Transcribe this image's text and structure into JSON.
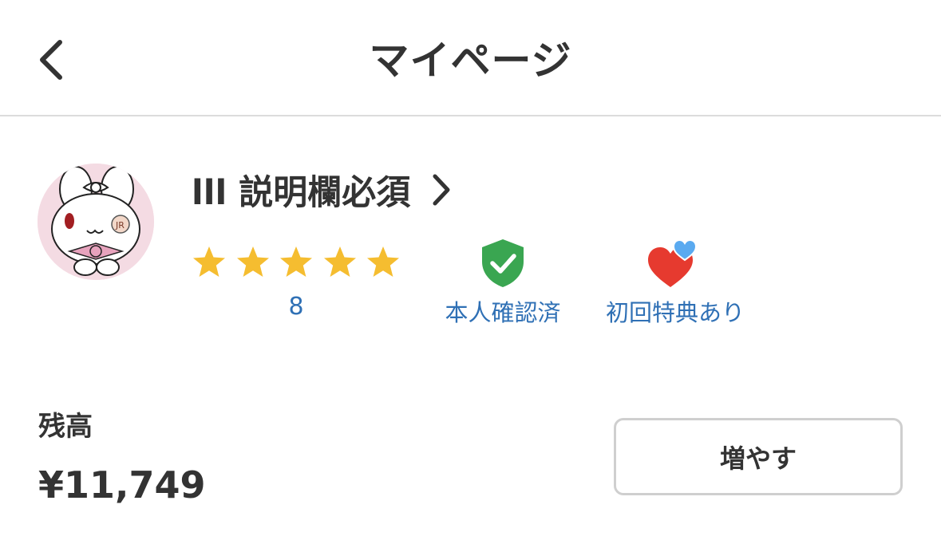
{
  "header": {
    "title": "マイページ",
    "back_icon": "chevron-left-icon"
  },
  "profile": {
    "name": "lll 説明欄必須",
    "name_chevron_icon": "chevron-right-icon",
    "avatar_icon": "avatar-bunny-image",
    "rating": {
      "stars": 5,
      "max_stars": 5,
      "star_color": "#f5bd30",
      "count": "8"
    },
    "badges": [
      {
        "label": "本人確認済",
        "icon": "shield-check-icon",
        "color": "#3aa651"
      },
      {
        "label": "初回特典あり",
        "icon": "hearts-icon",
        "color": "#e63a2f",
        "accent": "#5aaaf0"
      }
    ]
  },
  "balance": {
    "label": "残高",
    "amount": "¥11,749",
    "topup_label": "増やす"
  },
  "colors": {
    "link_blue": "#2f70b5",
    "text_dark": "#333333",
    "divider": "#dcdcdc"
  }
}
